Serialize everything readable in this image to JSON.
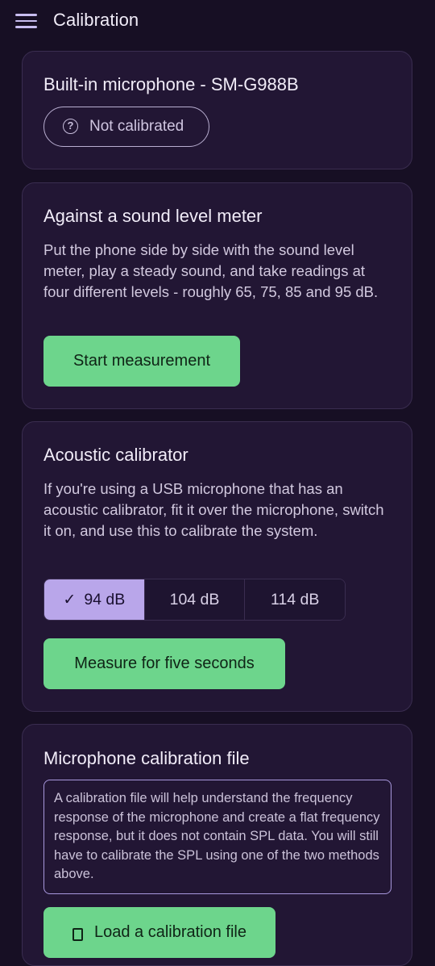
{
  "app": {
    "title": "Calibration",
    "menu_icon": "hamburger-menu-icon"
  },
  "device": {
    "name": "Built-in microphone - SM-G988B",
    "status_icon": "question-circle-icon",
    "status": "Not calibrated"
  },
  "sound_meter": {
    "title": "Against a sound level meter",
    "description": "Put the phone side by side with the sound level meter, play a steady sound, and take readings at four different levels - roughly 65, 75, 85 and 95 dB.",
    "button": "Start measurement"
  },
  "acoustic": {
    "title": "Acoustic calibrator",
    "description": "If you're using a USB microphone that has an acoustic calibrator, fit it over the microphone, switch it on, and use this to calibrate the system.",
    "options": [
      "94 dB",
      "104 dB",
      "114 dB"
    ],
    "selected": "94 dB",
    "check_icon": "check-icon",
    "button": "Measure for five seconds"
  },
  "calibration_file": {
    "title": "Microphone calibration file",
    "info": "A calibration file will help understand the frequency response of the microphone and create a flat frequency response, but it does not contain SPL data. You will still have to calibrate the SPL using one of the two methods above.",
    "button_icon": "file-upload-icon",
    "button": "Load a calibration file"
  },
  "colors": {
    "background": "#170f24",
    "card": "#221634",
    "accent_green": "#6dd58c",
    "selected_segment": "#b9a6ea"
  }
}
